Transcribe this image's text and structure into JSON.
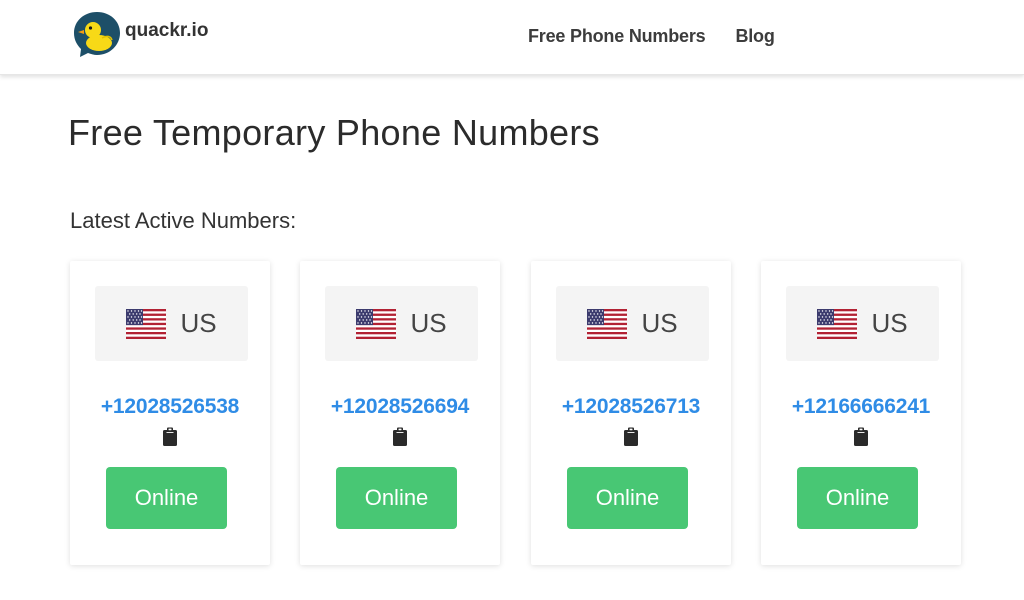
{
  "brand": {
    "name": "quackr.io",
    "logo_icon": "duck-logo-icon"
  },
  "nav": {
    "items": [
      "Free Phone Numbers",
      "Blog"
    ]
  },
  "page": {
    "title": "Free Temporary Phone Numbers",
    "section_title": "Latest Active Numbers:"
  },
  "cards": [
    {
      "country": "US",
      "flag_icon": "us-flag-icon",
      "number": "+12028526538",
      "copy_icon": "clipboard-icon",
      "status": "Online"
    },
    {
      "country": "US",
      "flag_icon": "us-flag-icon",
      "number": "+12028526694",
      "copy_icon": "clipboard-icon",
      "status": "Online"
    },
    {
      "country": "US",
      "flag_icon": "us-flag-icon",
      "number": "+12028526713",
      "copy_icon": "clipboard-icon",
      "status": "Online"
    },
    {
      "country": "US",
      "flag_icon": "us-flag-icon",
      "number": "+12166666241",
      "copy_icon": "clipboard-icon",
      "status": "Online"
    }
  ],
  "colors": {
    "accent_blue": "#2f8ce6",
    "online_green": "#48c774",
    "logo_teal": "#1d4f68",
    "duck_yellow": "#f7d917"
  }
}
